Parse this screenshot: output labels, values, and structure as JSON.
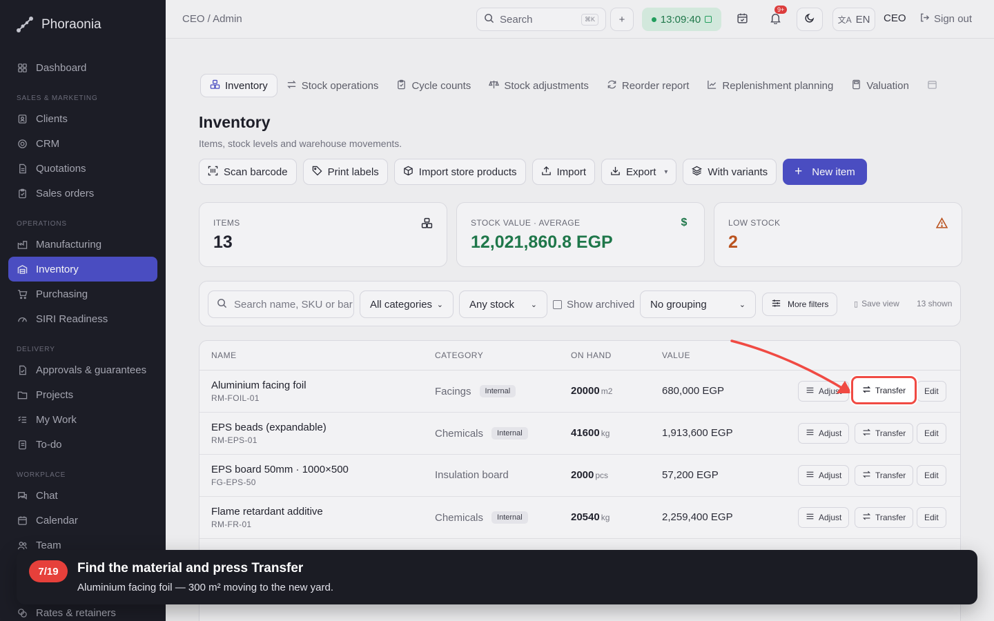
{
  "app": {
    "name": "Phoraonia"
  },
  "sidebar": {
    "dashboard": "Dashboard",
    "sections": [
      {
        "title": "SALES & MARKETING",
        "items": [
          "Clients",
          "CRM",
          "Quotations",
          "Sales orders"
        ]
      },
      {
        "title": "OPERATIONS",
        "items": [
          "Manufacturing",
          "Inventory",
          "Purchasing",
          "SIRI Readiness"
        ]
      },
      {
        "title": "DELIVERY",
        "items": [
          "Approvals & guarantees",
          "Projects",
          "My Work",
          "To-do"
        ]
      },
      {
        "title": "WORKPLACE",
        "items": [
          "Chat",
          "Calendar",
          "Team"
        ]
      }
    ],
    "bottom_item": "Rates & retainers",
    "active": "Inventory"
  },
  "topbar": {
    "breadcrumb": "CEO / Admin",
    "search_label": "Search",
    "search_kbd": "⌘K",
    "clock": "13:09:40",
    "notif_badge": "9+",
    "lang": "EN",
    "role": "CEO",
    "sign_out": "Sign out"
  },
  "tabs": [
    "Inventory",
    "Stock operations",
    "Cycle counts",
    "Stock adjustments",
    "Reorder report",
    "Replenishment planning",
    "Valuation"
  ],
  "page": {
    "title": "Inventory",
    "subtitle": "Items, stock levels and warehouse movements."
  },
  "actions": {
    "scan": "Scan barcode",
    "print": "Print labels",
    "import_store": "Import store products",
    "import": "Import",
    "export": "Export",
    "variants": "With variants",
    "new_item": "New item"
  },
  "stats": {
    "items_label": "ITEMS",
    "items_value": "13",
    "stock_label": "STOCK VALUE · AVERAGE",
    "stock_value": "12,021,860.8 EGP",
    "low_label": "LOW STOCK",
    "low_value": "2"
  },
  "filters": {
    "search_placeholder": "Search name, SKU or bar",
    "category": "All categories",
    "stock": "Any stock",
    "archived": "Show archived",
    "grouping": "No grouping",
    "more": "More filters",
    "save_view": "Save view",
    "shown": "13 shown"
  },
  "table": {
    "headers": {
      "name": "NAME",
      "category": "CATEGORY",
      "on_hand": "ON HAND",
      "value": "VALUE"
    },
    "btn_adjust": "Adjust",
    "btn_transfer": "Transfer",
    "btn_edit": "Edit",
    "rows": [
      {
        "name": "Aluminium facing foil",
        "sku": "RM-FOIL-01",
        "category": "Facings",
        "tag": "Internal",
        "qty": "20000",
        "unit": "m2",
        "value": "680,000 EGP"
      },
      {
        "name": "EPS beads (expandable)",
        "sku": "RM-EPS-01",
        "category": "Chemicals",
        "tag": "Internal",
        "qty": "41600",
        "unit": "kg",
        "value": "1,913,600 EGP"
      },
      {
        "name": "EPS board 50mm · 1000×500",
        "sku": "FG-EPS-50",
        "category": "Insulation board",
        "tag": "",
        "qty": "2000",
        "unit": "pcs",
        "value": "57,200 EGP"
      },
      {
        "name": "Flame retardant additive",
        "sku": "RM-FR-01",
        "category": "Chemicals",
        "tag": "Internal",
        "qty": "20540",
        "unit": "kg",
        "value": "2,259,400 EGP"
      }
    ]
  },
  "tour": {
    "step": "7/19",
    "title": "Find the material and press Transfer",
    "body": "Aluminium facing foil — 300 m² moving to the new yard."
  },
  "colors": {
    "accent": "#4b4fc7",
    "highlight": "#f04a43",
    "success": "#1f7a4b",
    "warning": "#c0551f"
  }
}
